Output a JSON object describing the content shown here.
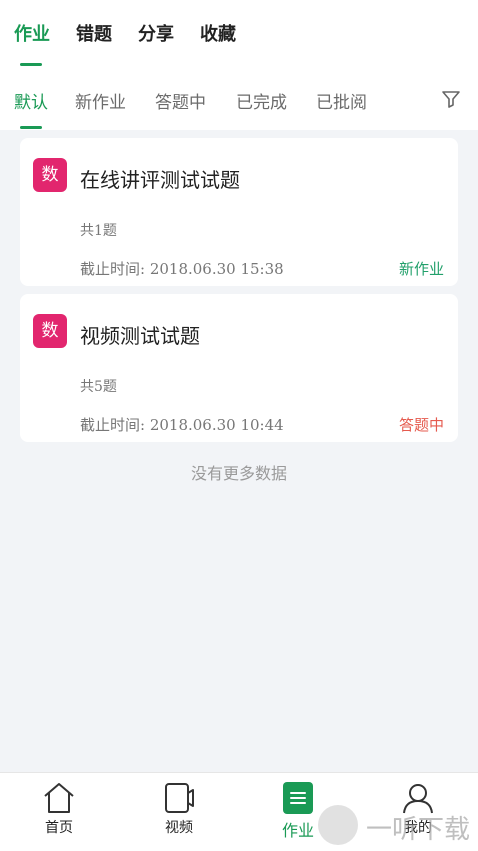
{
  "main_tabs": [
    {
      "label": "作业",
      "active": true
    },
    {
      "label": "错题",
      "active": false
    },
    {
      "label": "分享",
      "active": false
    },
    {
      "label": "收藏",
      "active": false
    }
  ],
  "sub_tabs": [
    {
      "label": "默认",
      "active": true
    },
    {
      "label": "新作业",
      "active": false
    },
    {
      "label": "答题中",
      "active": false
    },
    {
      "label": "已完成",
      "active": false
    },
    {
      "label": "已批阅",
      "active": false
    }
  ],
  "filter_icon": "filter-icon",
  "assignments": [
    {
      "badge": "数",
      "title": "在线讲评测试试题",
      "count": "共1题",
      "deadline": "截止时间: 2018.06.30  15:38",
      "status": "新作业",
      "status_color": "#22a06b"
    },
    {
      "badge": "数",
      "title": "视频测试试题",
      "count": "共5题",
      "deadline": "截止时间: 2018.06.30  10:44",
      "status": "答题中",
      "status_color": "#e55a4e"
    }
  ],
  "no_more_text": "没有更多数据",
  "bottom_nav": [
    {
      "label": "首页",
      "icon": "home-icon",
      "active": false
    },
    {
      "label": "视频",
      "icon": "video-icon",
      "active": false
    },
    {
      "label": "作业",
      "icon": "homework-icon",
      "active": true
    },
    {
      "label": "我的",
      "icon": "profile-icon",
      "active": false
    }
  ],
  "watermark": {
    "text": "一听下载",
    "icon": "listen-logo-icon"
  },
  "colors": {
    "accent": "#1a9a55",
    "badge": "#e2266e",
    "background": "#f2f4f7"
  }
}
